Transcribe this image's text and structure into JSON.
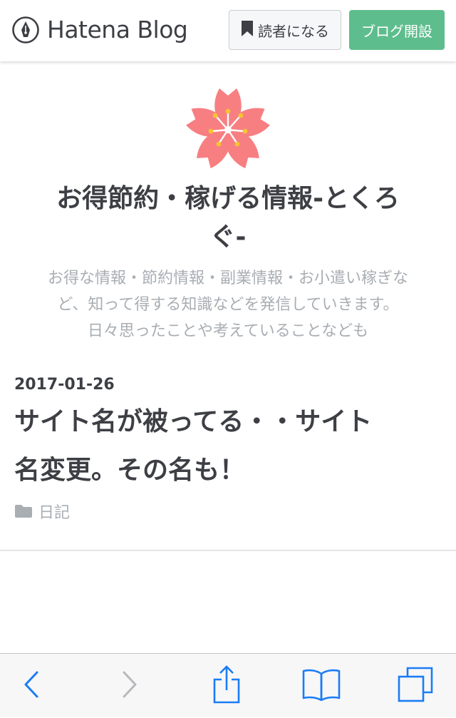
{
  "header": {
    "logo_text": "Hatena Blog",
    "subscribe_label": "読者になる",
    "start_blog_label": "ブログ開設"
  },
  "blog": {
    "title_line1": "お得節約・稼げる情報-とくろ",
    "title_line2": "ぐ-",
    "description_line1": "お得な情報・節約情報・副業情報・お小遣い稼ぎな",
    "description_line2": "ど、知って得する知識などを発信していきます。",
    "description_line3": "日々思ったことや考えていることなども"
  },
  "entry": {
    "date": "2017-01-26",
    "title_line1": "サイト名が被ってる・・サイト",
    "title_line2": "名変更。その名も！",
    "category": "日記"
  },
  "icons": {
    "logo": "hatena-pen-icon",
    "subscribe": "bookmark-icon",
    "category": "folder-icon",
    "back": "chevron-left-icon",
    "forward": "chevron-right-icon",
    "share": "share-icon",
    "bookmarks": "open-book-icon",
    "tabs": "tabs-icon"
  },
  "colors": {
    "accent_green": "#5ebd8d",
    "text": "#3d3f44",
    "muted": "#a9aeb3",
    "blossom": "#f77f82",
    "ios_blue": "#1b7cf5"
  }
}
